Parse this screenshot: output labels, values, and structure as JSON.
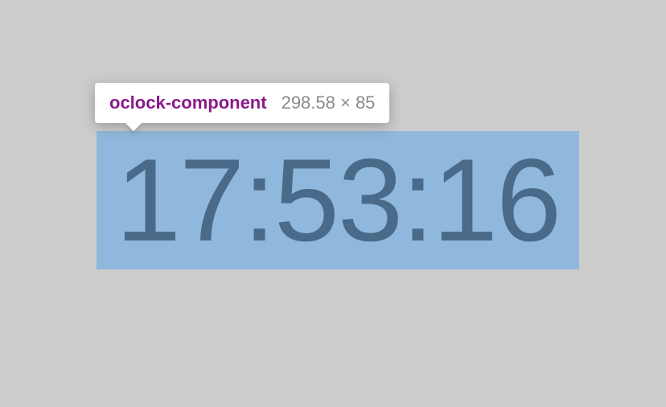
{
  "tooltip": {
    "component_name": "oclock-component",
    "dimensions": "298.58 × 85"
  },
  "clock": {
    "time": "17:53:16"
  }
}
